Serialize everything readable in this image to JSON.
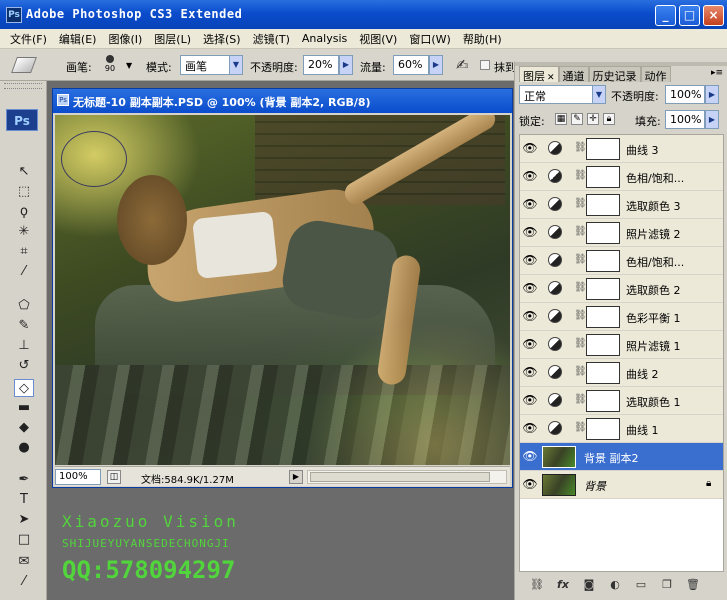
{
  "app": {
    "title": "Adobe Photoshop CS3 Extended",
    "logo": "Ps",
    "window_buttons": [
      "_",
      "□",
      "×"
    ]
  },
  "menu": [
    "文件(F)",
    "编辑(E)",
    "图像(I)",
    "图层(L)",
    "选择(S)",
    "滤镜(T)",
    "Analysis",
    "视图(V)",
    "窗口(W)",
    "帮助(H)"
  ],
  "options": {
    "brush_label": "画笔:",
    "brush_size": "90",
    "mode_label": "模式:",
    "mode_value": "画笔",
    "opacity_label": "不透明度:",
    "opacity_value": "20%",
    "flow_label": "流量:",
    "flow_value": "60%",
    "erase_history_label": "抹到"
  },
  "toolbox": {
    "logo": "Ps",
    "tools": [
      {
        "name": "move-tool",
        "glyph": "↖"
      },
      {
        "name": "marquee-tool",
        "glyph": "⬚"
      },
      {
        "name": "lasso-tool",
        "glyph": "ϙ"
      },
      {
        "name": "magic-wand-tool",
        "glyph": "✳"
      },
      {
        "name": "crop-tool",
        "glyph": "⌗"
      },
      {
        "name": "eyedropper-tool",
        "glyph": "⁄"
      },
      {
        "name": "healing-tool",
        "glyph": "⬠"
      },
      {
        "name": "brush-tool",
        "glyph": "✎"
      },
      {
        "name": "stamp-tool",
        "glyph": "⊥"
      },
      {
        "name": "history-brush-tool",
        "glyph": "↺"
      },
      {
        "name": "eraser-tool",
        "glyph": "◇"
      },
      {
        "name": "gradient-tool",
        "glyph": "▬"
      },
      {
        "name": "blur-tool",
        "glyph": "◆"
      },
      {
        "name": "dodge-tool",
        "glyph": "●"
      },
      {
        "name": "pen-tool",
        "glyph": "✒"
      },
      {
        "name": "type-tool",
        "glyph": "T"
      },
      {
        "name": "path-select-tool",
        "glyph": "➤"
      },
      {
        "name": "shape-tool",
        "glyph": "□"
      },
      {
        "name": "notes-tool",
        "glyph": "✉"
      },
      {
        "name": "eyedropper2-tool",
        "glyph": "⁄"
      },
      {
        "name": "hand-tool",
        "glyph": "✋"
      }
    ]
  },
  "document": {
    "title": "无标题-10 副本副本.PSD @ 100% (背景 副本2, RGB/8)",
    "zoom": "100%",
    "doc_info": "文档:584.9K/1.27M"
  },
  "watermark": {
    "line1": "Xiaozuo Vision",
    "line2": "SHIJUEYUYANSEDECHONGJI",
    "line3": "QQ:578094297"
  },
  "layers_panel": {
    "tabs": [
      "图层",
      "通道",
      "历史记录",
      "动作"
    ],
    "blend_mode": "正常",
    "opacity_label": "不透明度:",
    "opacity_value": "100%",
    "lock_label": "锁定:",
    "fill_label": "填充:",
    "fill_value": "100%",
    "layers": [
      {
        "name": "曲线 3",
        "type": "adjustment"
      },
      {
        "name": "色相/饱和...",
        "type": "adjustment"
      },
      {
        "name": "选取颜色 3",
        "type": "adjustment"
      },
      {
        "name": "照片滤镜 2",
        "type": "adjustment"
      },
      {
        "name": "色相/饱和...",
        "type": "adjustment"
      },
      {
        "name": "选取颜色 2",
        "type": "adjustment"
      },
      {
        "name": "色彩平衡 1",
        "type": "adjustment"
      },
      {
        "name": "照片滤镜 1",
        "type": "adjustment"
      },
      {
        "name": "曲线 2",
        "type": "adjustment"
      },
      {
        "name": "选取颜色 1",
        "type": "adjustment"
      },
      {
        "name": "曲线 1",
        "type": "adjustment"
      },
      {
        "name": "背景 副本2",
        "type": "pixel",
        "selected": true
      },
      {
        "name": "背景",
        "type": "background",
        "locked": true
      }
    ],
    "footer_icons": [
      "link-icon",
      "fx-icon",
      "mask-icon",
      "adjustment-icon",
      "folder-icon",
      "new-layer-icon",
      "trash-icon"
    ]
  }
}
